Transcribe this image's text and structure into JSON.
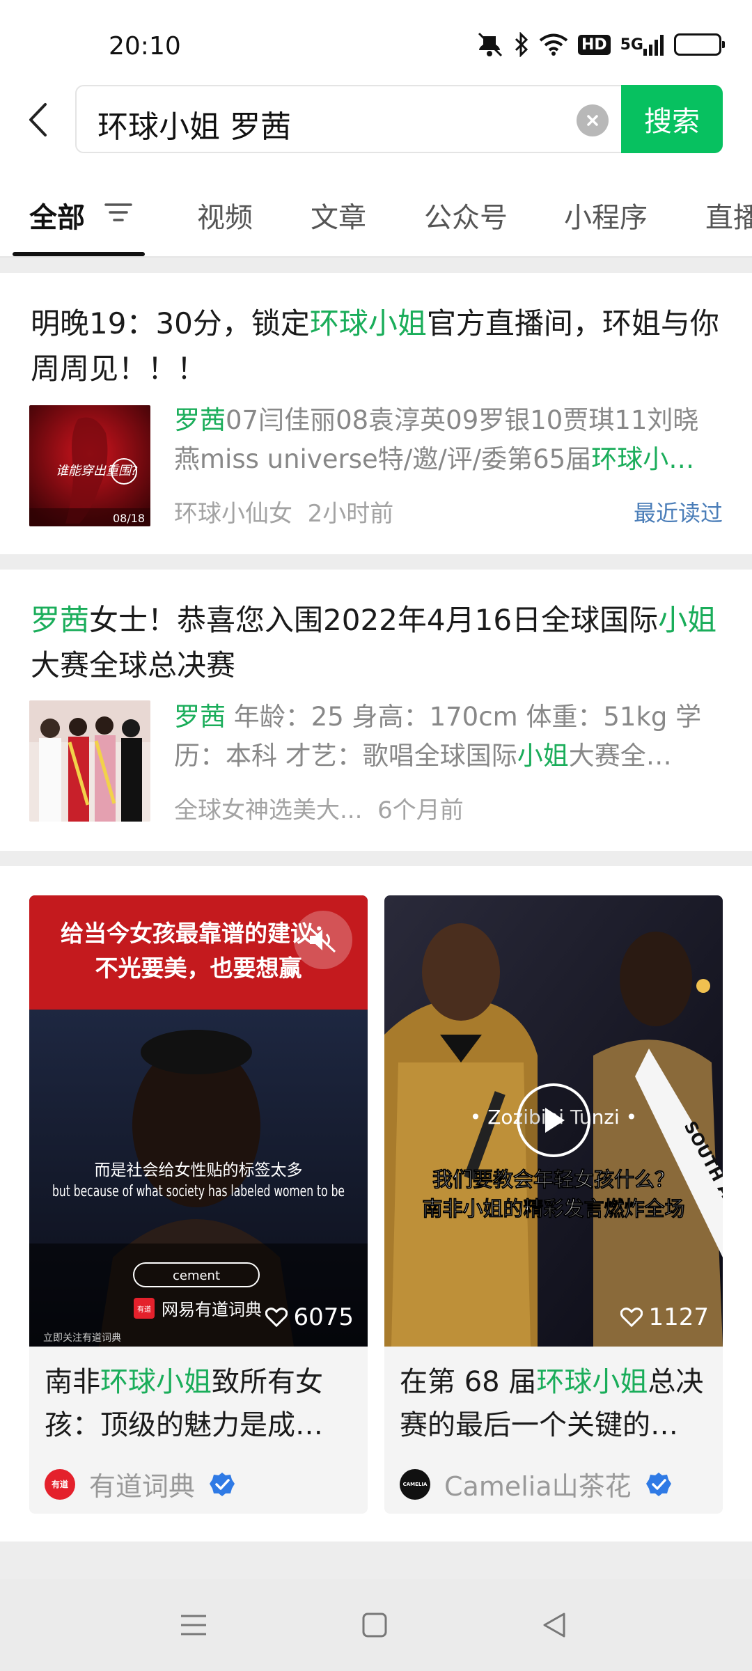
{
  "status_bar": {
    "time": "20:10",
    "hd": "HD",
    "network": "5G",
    "icons": [
      "mute-icon",
      "bluetooth-icon",
      "wifi-icon",
      "hd-badge",
      "signal-icon",
      "battery-icon"
    ]
  },
  "search": {
    "query": "环球小姐 罗茜",
    "button_label": "搜索"
  },
  "tabs": [
    {
      "label": "全部",
      "active": true
    },
    {
      "label": "视频"
    },
    {
      "label": "文章"
    },
    {
      "label": "公众号"
    },
    {
      "label": "小程序"
    },
    {
      "label": "直播"
    }
  ],
  "articles": [
    {
      "title_parts": [
        "明晚19：30分，锁定",
        "环球小姐",
        "官方直播间，环姐与你周周见！！！"
      ],
      "snippet_parts": [
        "罗茜",
        "07闫佳丽08袁淳英09罗银10贾琪11刘晓燕miss universe特/邀/评/委第65届",
        "环球小…"
      ],
      "source": "环球小仙女",
      "time": "2小时前",
      "badge": "最近读过",
      "thumb_text": "谁能穿出重围?",
      "thumb_date": "08/18"
    },
    {
      "title_parts": [
        "罗茜",
        "女士！恭喜您入围2022年4月16日全球国际",
        "小姐",
        "大赛全球总决赛"
      ],
      "snippet_parts": [
        "罗茜",
        " 年龄：25 身高：170cm 体重：51kg 学历：本科 才艺：歌唱全球国际",
        "小姐",
        "大赛全…"
      ],
      "source": "全球女神选美大...",
      "time": "6个月前"
    }
  ],
  "videos": [
    {
      "overlay_line1": "给当今女孩最靠谱的建议：",
      "overlay_line2": "不光要美，也要想赢",
      "subtitle_cn": "而是社会给女性贴的标签太多",
      "subtitle_en": "but because of what society has labeled women to be",
      "search_chip": "cement",
      "brand": "网易有道词典",
      "brand_logo": "有道",
      "follow_note": "立即关注有道词典",
      "likes": "6075",
      "title_parts": [
        "南非",
        "环球小姐",
        "致所有女孩：顶级的魅力是成…"
      ],
      "author": "有道词典",
      "author_logo": "有道",
      "verified": true
    },
    {
      "name_overlay": "• Zozibini Tunzi •",
      "caption_line1": "我们要教会年轻女孩什么？",
      "caption_line2": "南非小姐的精彩发言燃炸全场",
      "sash_text": "SOUTH AFRICA",
      "likes": "1127",
      "title_parts": [
        "在第 68 届",
        "环球小姐",
        "总决赛的最后一个关键的…"
      ],
      "author": "Camelia山茶花",
      "author_logo": "CAMELIA",
      "verified": true
    }
  ],
  "navbar": {
    "icons": [
      "menu-icon",
      "home-square-icon",
      "back-triangle-icon"
    ]
  },
  "colors": {
    "accent": "#07c160",
    "highlight": "#1aad5a",
    "link": "#4a7db8"
  }
}
